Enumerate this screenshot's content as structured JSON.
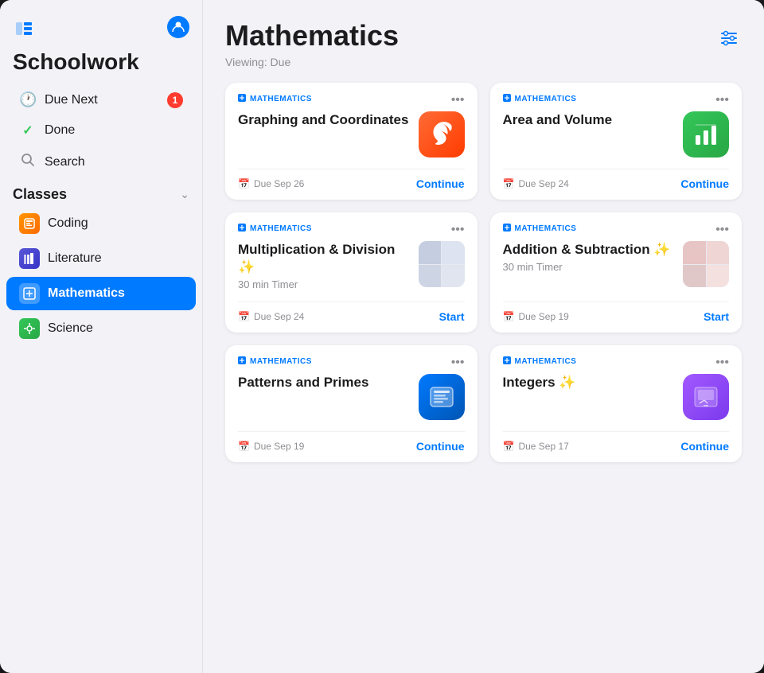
{
  "app": {
    "title": "Schoolwork",
    "window_icon": "⊞"
  },
  "sidebar": {
    "nav_items": [
      {
        "id": "due-next",
        "icon": "🕐",
        "label": "Due Next",
        "badge": "1"
      },
      {
        "id": "done",
        "icon": "✓",
        "label": "Done",
        "badge": null
      },
      {
        "id": "search",
        "icon": "🔍",
        "label": "Search",
        "badge": null
      }
    ],
    "classes_section": "Classes",
    "classes": [
      {
        "id": "coding",
        "label": "Coding",
        "color": "#ff9500",
        "icon": "🟧",
        "active": false
      },
      {
        "id": "literature",
        "label": "Literature",
        "color": "#5856d6",
        "icon": "📊",
        "active": false
      },
      {
        "id": "mathematics",
        "label": "Mathematics",
        "color": "#007aff",
        "icon": "📋",
        "active": true
      },
      {
        "id": "science",
        "label": "Science",
        "color": "#34c759",
        "icon": "🔬",
        "active": false
      }
    ]
  },
  "main": {
    "title": "Mathematics",
    "viewing_label": "Viewing: Due",
    "filter_icon": "sliders",
    "cards": [
      {
        "id": "graphing",
        "subject": "MATHEMATICS",
        "title": "Graphing and Coordinates",
        "subtitle": null,
        "app_type": "swift",
        "due": "Due Sep 26",
        "action": "Continue"
      },
      {
        "id": "area-volume",
        "subject": "MATHEMATICS",
        "title": "Area and Volume",
        "subtitle": null,
        "app_type": "numbers",
        "due": "Due Sep 24",
        "action": "Continue"
      },
      {
        "id": "multiplication",
        "subject": "MATHEMATICS",
        "title": "Multiplication & Division ✨",
        "subtitle": "30 min Timer",
        "app_type": "thumbnail",
        "due": "Due Sep 24",
        "action": "Start"
      },
      {
        "id": "addition",
        "subject": "MATHEMATICS",
        "title": "Addition & Subtraction ✨",
        "subtitle": "30 min Timer",
        "app_type": "thumbnail2",
        "due": "Due Sep 19",
        "action": "Start"
      },
      {
        "id": "patterns",
        "subject": "MATHEMATICS",
        "title": "Patterns and Primes",
        "subtitle": null,
        "app_type": "files",
        "due": "Due Sep 19",
        "action": "Continue"
      },
      {
        "id": "integers",
        "subject": "MATHEMATICS",
        "title": "Integers ✨",
        "subtitle": null,
        "app_type": "keynote",
        "due": "Due Sep 17",
        "action": "Continue"
      }
    ]
  }
}
